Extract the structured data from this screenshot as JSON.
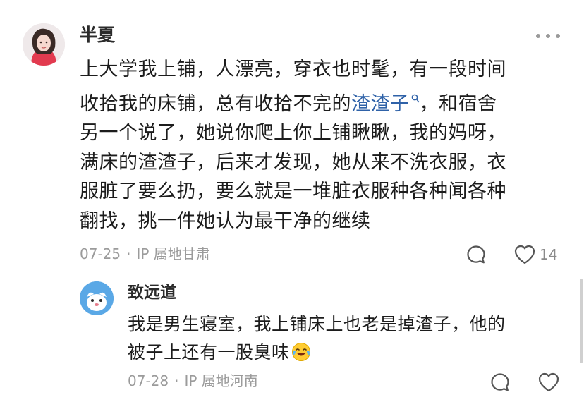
{
  "main_comment": {
    "author": "半夏",
    "lines": [
      "上大学我上铺，人漂亮，穿衣也时髦，有一段时间",
      "收拾我的床铺，总有收拾不完的",
      "，和宿舍",
      "另一个说了，她说你爬上你上铺瞅瞅，我的妈呀，",
      "满床的渣渣子，后来才发现，她从来不洗衣服，衣",
      "服脏了要么扔，要么就是一堆脏衣服种各种闻各种",
      "翻找，挑一件她认为最干净的继续"
    ],
    "link_text": "渣渣子",
    "link_icon": "search-link-icon",
    "date": "07-25",
    "separator": "·",
    "location": "IP 属地甘肃",
    "like_count": "14"
  },
  "reply": {
    "author": "致远道",
    "lines": [
      "我是男生寝室，我上铺床上也老是掉渣子，他的",
      "被子上还有一股臭味"
    ],
    "emoji": "crying-laughing-emoji",
    "date": "07-28",
    "separator": "·",
    "location": "IP 属地河南"
  },
  "colors": {
    "link": "#2f62a8",
    "meta": "#9b9b9b",
    "text": "#1c1c1c"
  }
}
